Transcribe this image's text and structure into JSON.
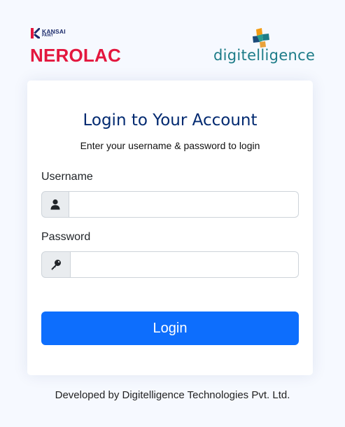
{
  "brand": {
    "kansai_line1": "KANSAI",
    "kansai_line2": "PAINT",
    "nerolac": "NEROLAC",
    "digitelligence": "digitelligence"
  },
  "login": {
    "title": "Login to Your Account",
    "subtitle": "Enter your username & password to login",
    "username_label": "Username",
    "username_value": "",
    "username_icon": "person-icon",
    "password_label": "Password",
    "password_value": "",
    "password_icon": "key-icon",
    "button_label": "Login"
  },
  "footer": {
    "text": "Developed by Digitelligence Technologies Pvt. Ltd."
  },
  "colors": {
    "page_bg": "#f6f9ff",
    "title": "#012970",
    "button": "#0d6efd",
    "nerolac_red": "#e3173e",
    "digitelligence_teal": "#1d7c88"
  }
}
